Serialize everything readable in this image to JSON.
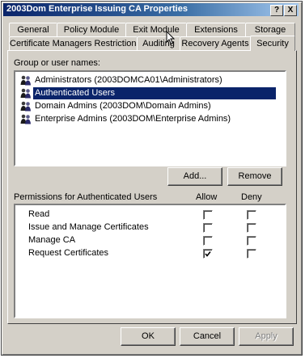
{
  "window": {
    "title": "2003Dom Enterprise Issuing CA Properties",
    "help_glyph": "?",
    "close_glyph": "X"
  },
  "tabs_back": [
    "General",
    "Policy Module",
    "Exit Module",
    "Extensions",
    "Storage"
  ],
  "tabs_front": [
    "Certificate Managers Restrictions",
    "Auditing",
    "Recovery Agents",
    "Security"
  ],
  "groups": {
    "label": "Group or user names:",
    "items": [
      "Administrators (2003DOMCA01\\Administrators)",
      "Authenticated Users",
      "Domain Admins (2003DOM\\Domain Admins)",
      "Enterprise Admins (2003DOM\\Enterprise Admins)"
    ],
    "selected_index": 1,
    "add_label": "Add...",
    "remove_label": "Remove"
  },
  "permissions": {
    "label": "Permissions for Authenticated Users",
    "allow_header": "Allow",
    "deny_header": "Deny",
    "rows": [
      {
        "name": "Read",
        "allow": false,
        "deny": false
      },
      {
        "name": "Issue and Manage Certificates",
        "allow": false,
        "deny": false
      },
      {
        "name": "Manage CA",
        "allow": false,
        "deny": false
      },
      {
        "name": "Request Certificates",
        "allow": true,
        "deny": false
      }
    ]
  },
  "footer": {
    "ok_label": "OK",
    "cancel_label": "Cancel",
    "apply_label": "Apply"
  },
  "colors": {
    "selection": "#0a246a",
    "face": "#d4d0c8",
    "titlebar": "#0a246a"
  },
  "icons": {
    "group_icon": "users-group-icon",
    "cursor": "arrow-cursor-icon"
  }
}
